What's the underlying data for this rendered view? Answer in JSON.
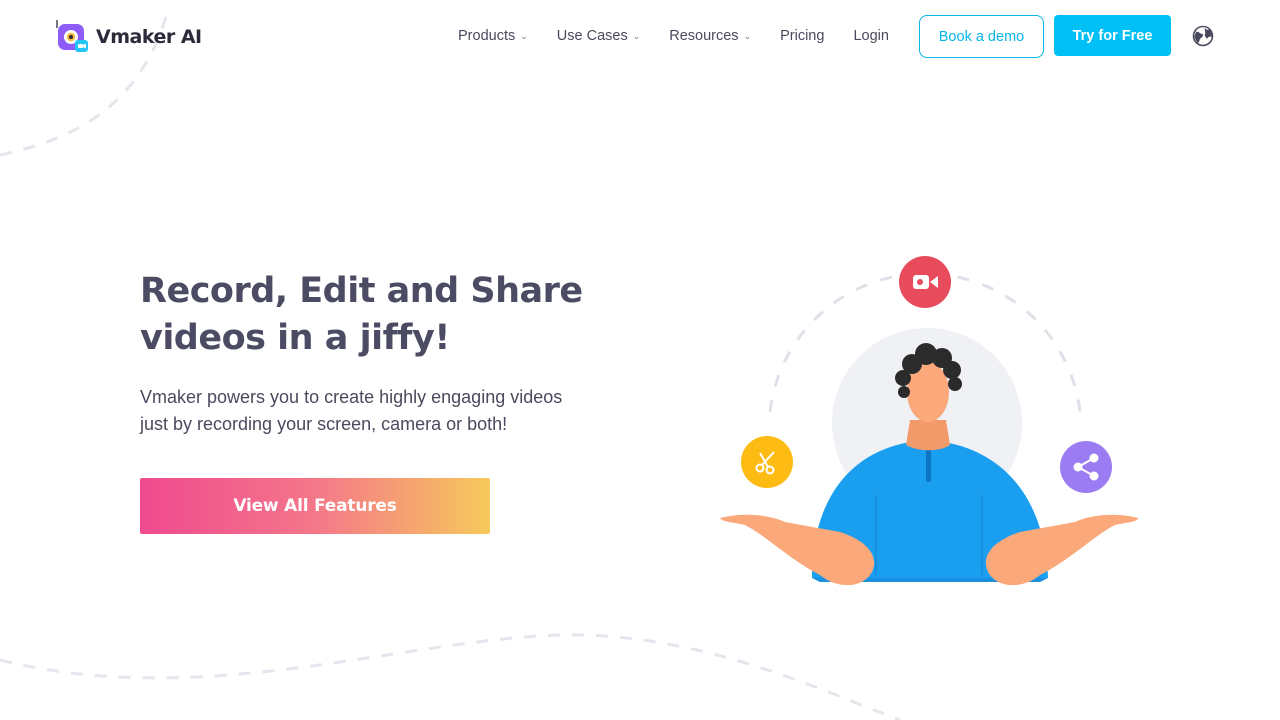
{
  "brand": {
    "name": "Vmaker AI",
    "colors": {
      "accent": "#00c0f5",
      "logo_purple": "#8e5cf6",
      "title": "#4b4b64"
    }
  },
  "nav": {
    "items": [
      {
        "label": "Products",
        "has_dropdown": true
      },
      {
        "label": "Use Cases",
        "has_dropdown": true
      },
      {
        "label": "Resources",
        "has_dropdown": true
      },
      {
        "label": "Pricing",
        "has_dropdown": false
      },
      {
        "label": "Login",
        "has_dropdown": false
      }
    ],
    "dropdown_glyph": "⌄",
    "book_demo_label": "Book a demo",
    "try_free_label": "Try for Free",
    "globe_icon": "globe-icon"
  },
  "hero": {
    "title_line1": "Record, Edit and Share",
    "title_line2": "videos in a jiffy!",
    "subtitle_line1": "Vmaker powers you to create highly engaging videos",
    "subtitle_line2": "just by recording your screen, camera or both!",
    "cta_label": "View All Features"
  },
  "illustration": {
    "icons": [
      "video-camera-icon",
      "scissors-icon",
      "share-icon"
    ],
    "colors": {
      "record": "#e84b5c",
      "edit": "#fdbb13",
      "share": "#9b7cf2",
      "shirt": "#1a9ff0",
      "skin": "#fba97b"
    }
  }
}
